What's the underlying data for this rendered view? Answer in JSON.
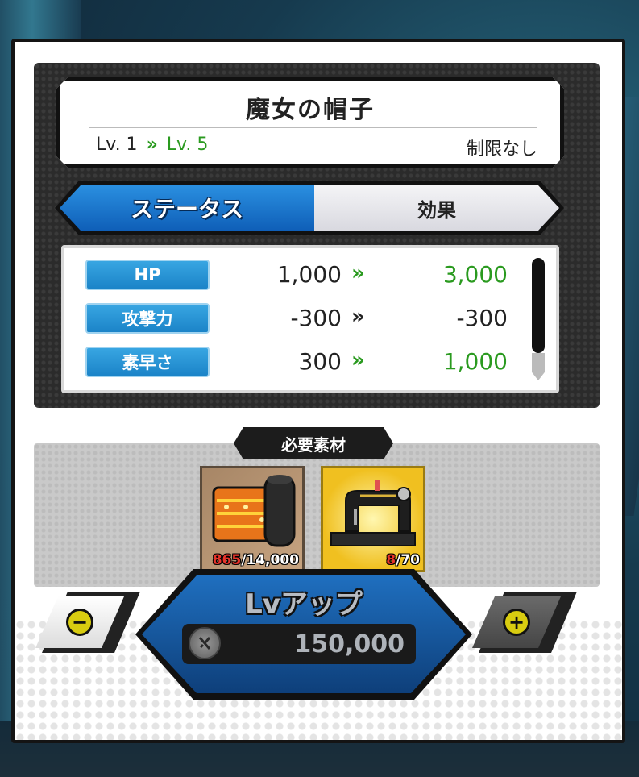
{
  "item": {
    "name": "魔女の帽子",
    "level_from": "Lv. 1",
    "level_arrow": "»",
    "level_to": "Lv. 5",
    "limit": "制限なし"
  },
  "tabs": [
    {
      "label": "ステータス",
      "active": true
    },
    {
      "label": "効果",
      "active": false
    }
  ],
  "stats": [
    {
      "label": "HP",
      "from": "1,000",
      "arrow": "»",
      "to": "3,000",
      "increased": true
    },
    {
      "label": "攻撃力",
      "from": "-300",
      "arrow": "»",
      "to": "-300",
      "increased": false
    },
    {
      "label": "素早さ",
      "from": "300",
      "arrow": "»",
      "to": "1,000",
      "increased": true
    }
  ],
  "materials": {
    "label": "必要素材",
    "items": [
      {
        "icon": "rolled-carpet-icon",
        "have": "865",
        "need": "/14,000"
      },
      {
        "icon": "sewing-machine-icon",
        "have": "8",
        "need": "/70"
      }
    ]
  },
  "controls": {
    "minus_symbol": "−",
    "plus_symbol": "+",
    "lvup_label": "Lvアップ",
    "coin_icon": "coin-icon",
    "cost": "150,000"
  },
  "colors": {
    "accent_blue": "#1b84c8",
    "increase_green": "#2a9a1f",
    "have_red": "#e8342a"
  }
}
